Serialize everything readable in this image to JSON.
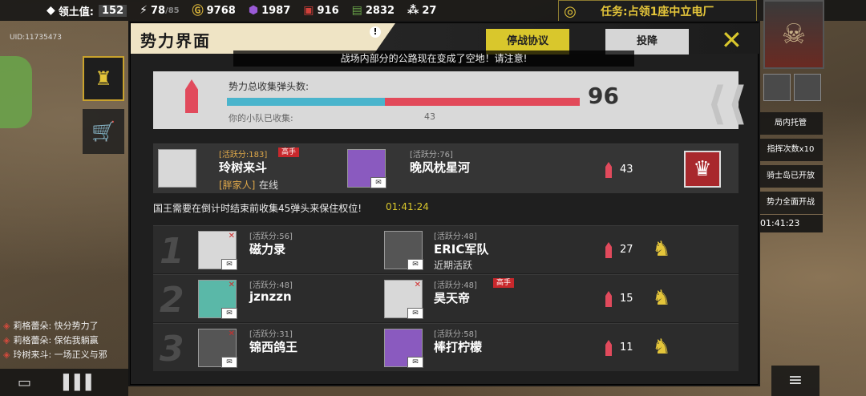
{
  "topbar": {
    "territory": {
      "label": "领土值:",
      "value": "152"
    },
    "energy": {
      "value": "78",
      "max": "/85"
    },
    "coins": "9768",
    "gems": "1987",
    "fuel": "916",
    "cash": "2832",
    "ammo": "27"
  },
  "task": {
    "label": "任务:",
    "text": "占领1座中立电厂"
  },
  "uid": "UID:11735473",
  "chat": [
    {
      "text": "莉格蕾朵: 快分势力了"
    },
    {
      "text": "莉格蕾朵: 保佑我躺赢"
    },
    {
      "text": "玲树来斗: 一场正义与邪"
    }
  ],
  "right_menu": {
    "item1": "局内托管",
    "item2": "指挥次数x10",
    "item3": "骑士岛已开放",
    "item4": "势力全面开战",
    "timer": "01:41:23"
  },
  "dialog": {
    "title": "势力界面",
    "notice": "战场内部分的公路现在变成了空地！请注意!",
    "truce_button": "停战协议",
    "surrender_button": "投降",
    "progress": {
      "label": "势力总收集弹头数:",
      "total": "96",
      "sub_label": "你的小队已收集:",
      "collected": "43",
      "fill_fraction": 0.448
    },
    "king": {
      "p1": {
        "score": "[活跃分:183]",
        "tag": "高手",
        "name": "玲树来斗",
        "role": "[胖家人]",
        "status": "在线"
      },
      "p2": {
        "score": "[活跃分:76]",
        "name": "晚风枕星河"
      },
      "ammo": "43"
    },
    "king_note": "国王需要在倒计时结束前收集45弹头来保住权位!",
    "king_timer": "01:41:24",
    "rows": [
      {
        "rank": "1",
        "p1": {
          "score": "[活跃分:56]",
          "name": "磁力录"
        },
        "p2": {
          "score": "[活跃分:48]",
          "name": "ERIC军队",
          "status": "近期活跃"
        },
        "ammo": "27"
      },
      {
        "rank": "2",
        "p1": {
          "score": "[活跃分:48]",
          "name": "jznzzn"
        },
        "p2": {
          "score": "[活跃分:48]",
          "tag": "高手",
          "name": "昊天帝"
        },
        "ammo": "15"
      },
      {
        "rank": "3",
        "p1": {
          "score": "[活跃分:31]",
          "name": "锦西鸽王"
        },
        "p2": {
          "score": "[活跃分:58]",
          "name": "棒打柠檬"
        },
        "ammo": "11"
      }
    ]
  },
  "colors": {
    "accent": "#d9c72c",
    "danger": "#e14a5c",
    "progress_blue": "#4ab4cc"
  }
}
